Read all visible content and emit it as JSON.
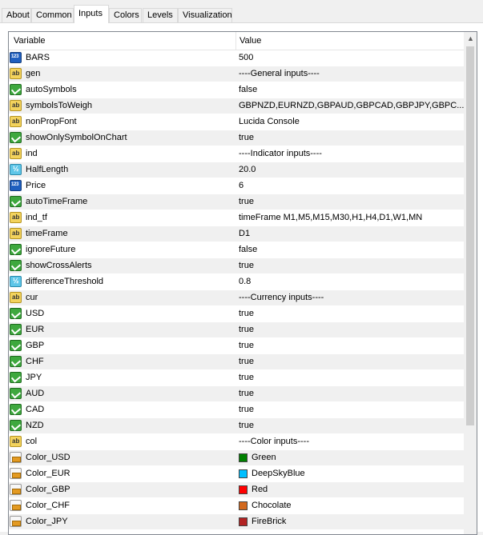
{
  "tabs": [
    "About",
    "Common",
    "Inputs",
    "Colors",
    "Levels",
    "Visualization"
  ],
  "active_tab": "Inputs",
  "grid": {
    "header": {
      "variable": "Variable",
      "value": "Value"
    },
    "rows": [
      {
        "icon": "int-icon",
        "variable": "BARS",
        "value": "500"
      },
      {
        "icon": "string-icon",
        "variable": "gen",
        "value": "----General inputs----"
      },
      {
        "icon": "bool-icon",
        "variable": "autoSymbols",
        "value": "false"
      },
      {
        "icon": "string-icon",
        "variable": "symbolsToWeigh",
        "value": "GBPNZD,EURNZD,GBPAUD,GBPCAD,GBPJPY,GBPC..."
      },
      {
        "icon": "string-icon",
        "variable": "nonPropFont",
        "value": "Lucida Console"
      },
      {
        "icon": "bool-icon",
        "variable": "showOnlySymbolOnChart",
        "value": "true"
      },
      {
        "icon": "string-icon",
        "variable": "ind",
        "value": "----Indicator inputs----"
      },
      {
        "icon": "double-icon",
        "variable": "HalfLength",
        "value": "20.0"
      },
      {
        "icon": "int-icon",
        "variable": "Price",
        "value": "6"
      },
      {
        "icon": "bool-icon",
        "variable": "autoTimeFrame",
        "value": "true"
      },
      {
        "icon": "string-icon",
        "variable": "ind_tf",
        "value": "timeFrame M1,M5,M15,M30,H1,H4,D1,W1,MN"
      },
      {
        "icon": "string-icon",
        "variable": "timeFrame",
        "value": "D1"
      },
      {
        "icon": "bool-icon",
        "variable": "ignoreFuture",
        "value": "false"
      },
      {
        "icon": "bool-icon",
        "variable": "showCrossAlerts",
        "value": "true"
      },
      {
        "icon": "double-icon",
        "variable": "differenceThreshold",
        "value": "0.8"
      },
      {
        "icon": "string-icon",
        "variable": "cur",
        "value": "----Currency inputs----"
      },
      {
        "icon": "bool-icon",
        "variable": "USD",
        "value": "true"
      },
      {
        "icon": "bool-icon",
        "variable": "EUR",
        "value": "true"
      },
      {
        "icon": "bool-icon",
        "variable": "GBP",
        "value": "true"
      },
      {
        "icon": "bool-icon",
        "variable": "CHF",
        "value": "true"
      },
      {
        "icon": "bool-icon",
        "variable": "JPY",
        "value": "true"
      },
      {
        "icon": "bool-icon",
        "variable": "AUD",
        "value": "true"
      },
      {
        "icon": "bool-icon",
        "variable": "CAD",
        "value": "true"
      },
      {
        "icon": "bool-icon",
        "variable": "NZD",
        "value": "true"
      },
      {
        "icon": "string-icon",
        "variable": "col",
        "value": "----Color inputs----"
      },
      {
        "icon": "color-icon",
        "variable": "Color_USD",
        "value": "Green",
        "swatch": "#008000"
      },
      {
        "icon": "color-icon",
        "variable": "Color_EUR",
        "value": "DeepSkyBlue",
        "swatch": "#00bfff"
      },
      {
        "icon": "color-icon",
        "variable": "Color_GBP",
        "value": "Red",
        "swatch": "#ff0000"
      },
      {
        "icon": "color-icon",
        "variable": "Color_CHF",
        "value": "Chocolate",
        "swatch": "#d2691e"
      },
      {
        "icon": "color-icon",
        "variable": "Color_JPY",
        "value": "FireBrick",
        "swatch": "#b22222"
      }
    ]
  },
  "scrollbar": {
    "icon": "scroll-up-arrow-icon"
  }
}
